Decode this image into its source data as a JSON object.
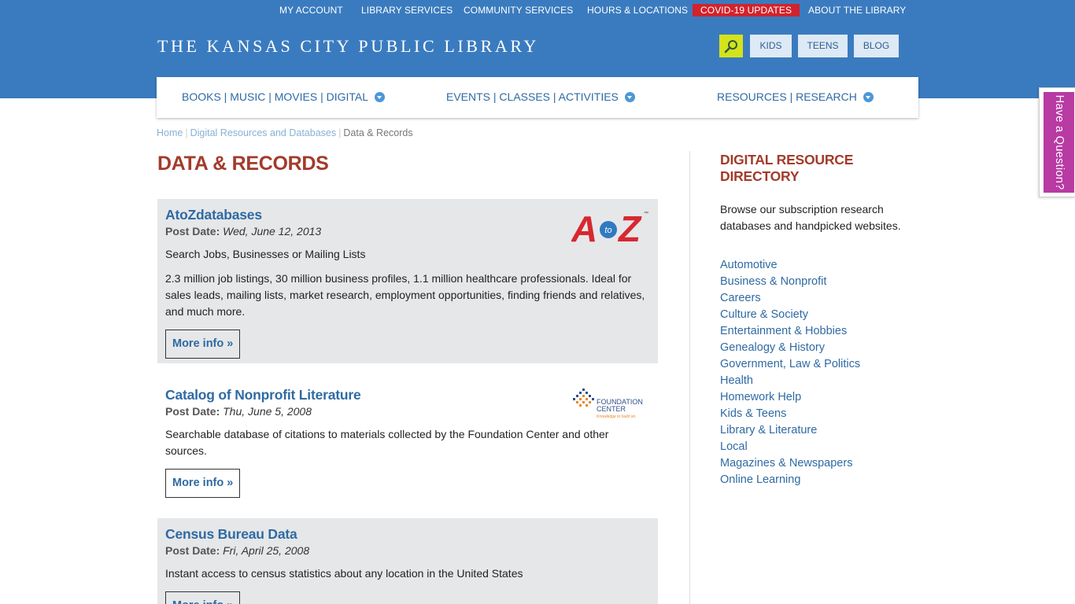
{
  "topnav": {
    "my_account": "MY ACCOUNT",
    "library_services": "LIBRARY SERVICES",
    "community_services": "COMMUNITY SERVICES",
    "hours_locations": "HOURS & LOCATIONS",
    "covid": "COVID-19 UPDATES",
    "about": "ABOUT THE LIBRARY"
  },
  "header": {
    "logo_text": "THE KANSAS CITY PUBLIC LIBRARY",
    "kids": "KIDS",
    "teens": "TEENS",
    "blog": "BLOG"
  },
  "mainnav": {
    "books": "BOOKS | MUSIC | MOVIES | DIGITAL",
    "events": "EVENTS | CLASSES | ACTIVITIES",
    "resources": "RESOURCES | RESEARCH"
  },
  "breadcrumb": {
    "home": "Home",
    "digital": "Digital Resources and Databases",
    "current": "Data & Records"
  },
  "page": {
    "title": "DATA & RECORDS"
  },
  "entries": [
    {
      "title": "AtoZdatabases",
      "post_label": "Post Date:",
      "date": "Wed, June 12, 2013",
      "summary": "Search Jobs, Businesses or Mailing Lists",
      "description": "2.3 million job listings, 30 million business profiles, 1.1 million healthcare professionals. Ideal for sales leads, mailing lists, market research, employment opportunities, finding friends and relatives, and much more.",
      "more": "More info »",
      "logo_text_a": "A",
      "logo_text_to": "to",
      "logo_text_z": "Z",
      "logo_tm": "™"
    },
    {
      "title": "Catalog of Nonprofit Literature",
      "post_label": "Post Date:",
      "date": "Thu, June 5, 2008",
      "description": "Searchable database of citations to materials collected by the Foundation Center and other sources.",
      "more": "More info »",
      "logo_line1": "FOUNDATION",
      "logo_line2": "CENTER",
      "logo_tagline": "Knowledge to build on."
    },
    {
      "title": "Census Bureau Data",
      "post_label": "Post Date:",
      "date": "Fri, April 25, 2008",
      "description": "Instant access to census statistics about any location in the United States",
      "more": "More info »"
    }
  ],
  "sidebar": {
    "title": "DIGITAL RESOURCE DIRECTORY",
    "description": "Browse our subscription research databases and handpicked websites.",
    "categories": [
      "Automotive",
      "Business & Nonprofit",
      "Careers",
      "Culture & Society",
      "Entertainment & Hobbies",
      "Genealogy & History",
      "Government, Law & Politics",
      "Health",
      "Homework Help",
      "Kids & Teens",
      "Library & Literature",
      "Local",
      "Magazines & Newspapers",
      "Online Learning"
    ]
  },
  "question_tab": {
    "label": "Have a Question?"
  },
  "colors": {
    "header_blue": "#3a7bbf",
    "title_red": "#a33b2b",
    "link_blue": "#2f6aa3",
    "covid_red": "#d0232c",
    "search_yellow": "#d5e21c",
    "question_magenta": "#b83aa3"
  },
  "icons": {
    "search": "search-icon",
    "dropdown": "chevron-down-icon"
  }
}
